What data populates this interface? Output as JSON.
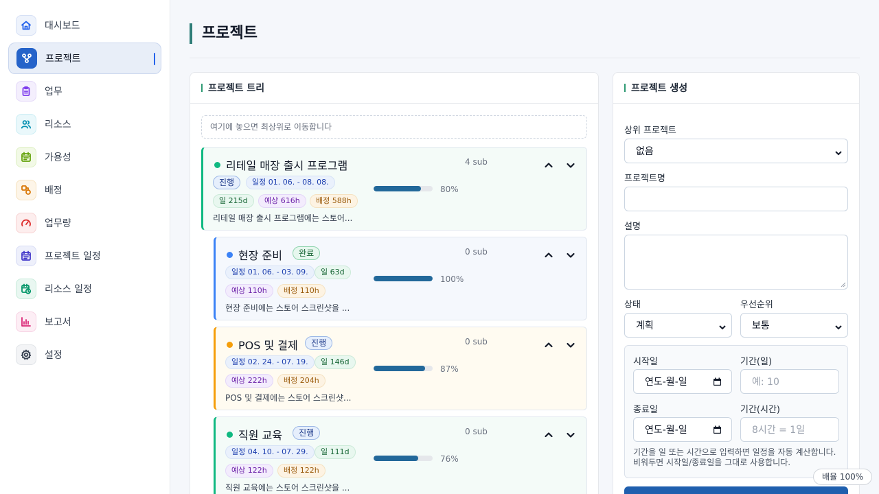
{
  "sidebar": {
    "items": [
      {
        "label": "대시보드",
        "icon": "home-icon",
        "color": "#2563eb",
        "bg": "#eef3fc",
        "border": "#d6e0f5"
      },
      {
        "label": "프로젝트",
        "icon": "project-tree-icon",
        "color": "#ffffff",
        "bg": "#2563c9",
        "border": "#2563c9",
        "active": true
      },
      {
        "label": "업무",
        "icon": "clipboard-icon",
        "color": "#7c3aed",
        "bg": "#f4effd",
        "border": "#e5daf9"
      },
      {
        "label": "리소스",
        "icon": "users-icon",
        "color": "#0891b2",
        "bg": "#eaf8fb",
        "border": "#cdeef4"
      },
      {
        "label": "가용성",
        "icon": "calendar-icon",
        "color": "#65a30d",
        "bg": "#f2f9e6",
        "border": "#dff0c6"
      },
      {
        "label": "배정",
        "icon": "assign-icon",
        "color": "#d97706",
        "bg": "#fdf5e8",
        "border": "#f6e3c1"
      },
      {
        "label": "업무량",
        "icon": "gauge-icon",
        "color": "#dc2626",
        "bg": "#fdeeee",
        "border": "#f7d3d3"
      },
      {
        "label": "프로젝트 일정",
        "icon": "calendar-schedule-icon",
        "color": "#4338ca",
        "bg": "#eef0fb",
        "border": "#d9ddf5"
      },
      {
        "label": "리소스 일정",
        "icon": "calendar-clock-icon",
        "color": "#059669",
        "bg": "#e9f7f1",
        "border": "#c9ecdc"
      },
      {
        "label": "보고서",
        "icon": "bar-chart-icon",
        "color": "#db2777",
        "bg": "#fdeef5",
        "border": "#f7d3e4"
      },
      {
        "label": "설정",
        "icon": "gear-icon",
        "color": "#374151",
        "bg": "#f3f4f6",
        "border": "#e1e4e8"
      }
    ]
  },
  "page": {
    "title": "프로젝트"
  },
  "tree": {
    "title": "프로젝트 트리",
    "drop_zone": "여기에 놓으면 최상위로 이동합니다",
    "nodes": [
      {
        "title": "리테일 매장 출시 프로그램",
        "status": "진행",
        "status_type": "prog",
        "dot": "#10b981",
        "accent": "#10b981",
        "bg": "#f4fbf8",
        "date": "일정 01. 06. - 08. 08.",
        "days": "일 215d",
        "est": "예상 616h",
        "alloc": "배정 588h",
        "desc": "리테일 매장 출시 프로그램에는 스토어...",
        "sub": "4 sub",
        "progress": 80,
        "progress_label": "80%"
      },
      {
        "title": "현장 준비",
        "status": "완료",
        "status_type": "done",
        "dot": "#3b82f6",
        "accent": "#3b82f6",
        "bg": "#f5f8fd",
        "date": "일정 01. 06. - 03. 09.",
        "days": "일 63d",
        "est": "예상 110h",
        "alloc": "배정 110h",
        "desc": "현장 준비에는 스토어 스크린샷을 ...",
        "sub": "0 sub",
        "progress": 100,
        "progress_label": "100%"
      },
      {
        "title": "POS 및 결제",
        "status": "진행",
        "status_type": "prog",
        "dot": "#f59e0b",
        "accent": "#f59e0b",
        "bg": "#fffbf1",
        "date": "일정 02. 24. - 07. 19.",
        "days": "일 146d",
        "est": "예상 222h",
        "alloc": "배정 204h",
        "desc": "POS 및 결제에는 스토어 스크린샷...",
        "sub": "0 sub",
        "progress": 87,
        "progress_label": "87%"
      },
      {
        "title": "직원 교육",
        "status": "진행",
        "status_type": "prog",
        "dot": "#10b981",
        "accent": "#10b981",
        "bg": "#f4fbf8",
        "date": "일정 04. 10. - 07. 29.",
        "days": "일 111d",
        "est": "예상 122h",
        "alloc": "배정 122h",
        "desc": "직원 교육에는 스토어 스크린샷을 ...",
        "sub": "0 sub",
        "progress": 76,
        "progress_label": "76%"
      }
    ]
  },
  "form": {
    "title": "프로젝트 생성",
    "parent_label": "상위 프로젝트",
    "parent_value": "없음",
    "name_label": "프로젝트명",
    "name_value": "",
    "desc_label": "설명",
    "status_label": "상태",
    "status_value": "계획",
    "priority_label": "우선순위",
    "priority_value": "보통",
    "start_label": "시작일",
    "start_value": "연도-월-일",
    "duration_days_label": "기간(일)",
    "duration_days_placeholder": "예: 10",
    "end_label": "종료일",
    "end_value": "연도-월-일",
    "duration_hours_label": "기간(시간)",
    "duration_hours_placeholder": "8시간 = 1일",
    "help": "기간을 일 또는 시간으로 입력하면 일정을 자동 계산합니다. 비워두면 시작일/종료일을 그대로 사용합니다."
  },
  "zoom": {
    "label": "배율 100%"
  }
}
